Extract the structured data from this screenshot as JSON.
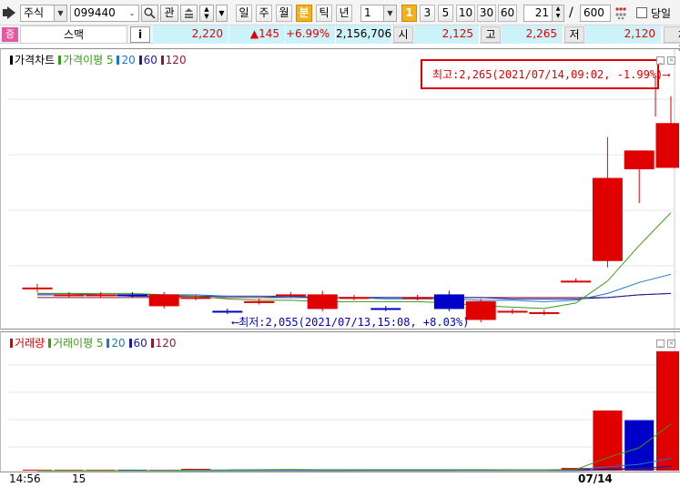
{
  "toolbar": {
    "market_select": "주식",
    "stock_code": "099440",
    "watch_label": "관",
    "period_buttons": [
      "일",
      "주",
      "월",
      "분",
      "틱",
      "년"
    ],
    "active_period": "분",
    "interval_value": "1",
    "interval_presets": [
      "1",
      "3",
      "5",
      "10",
      "30",
      "60"
    ],
    "active_interval": "1",
    "view_count": "21",
    "total_count": "600",
    "separator": "/",
    "same_day_label": "당일"
  },
  "quote": {
    "badge": "증",
    "name": "스맥",
    "info_label": "i",
    "price": "2,220",
    "change": "▲145",
    "change_rate": "+6.99%",
    "volume": "2,156,706",
    "open_label": "시",
    "open": "2,125",
    "high_label": "고",
    "high": "2,265",
    "low_label": "저",
    "low": "2,120",
    "trade_label": "체결강"
  },
  "price_pane": {
    "legend": [
      {
        "label": "가격차트",
        "color": "#000000"
      },
      {
        "label": "가격이평 5",
        "color": "#3a9a1a"
      },
      {
        "label": "20",
        "color": "#1a78c8"
      },
      {
        "label": "60",
        "color": "#1a1aa0"
      },
      {
        "label": "120",
        "color": "#8a1a3a"
      }
    ],
    "high_annotation": "최고:2,265(2021/07/14,09:02, -1.99%)⟶",
    "low_annotation": "⟵최저:2,055(2021/07/13,15:08, +8.03%)"
  },
  "volume_pane": {
    "legend": [
      {
        "label": "거래량",
        "color": "#e00000"
      },
      {
        "label": "거래이평 5",
        "color": "#3a9a1a"
      },
      {
        "label": "20",
        "color": "#1a78c8"
      },
      {
        "label": "60",
        "color": "#1a1aa0"
      },
      {
        "label": "120",
        "color": "#8a1a3a"
      }
    ]
  },
  "time_axis": {
    "labels": [
      "14:56",
      "15",
      "07/14"
    ]
  },
  "colors": {
    "up": "#e00000",
    "down": "#0000c8",
    "ma5": "#3a9a1a",
    "ma20": "#1a78c8",
    "ma60": "#1a1aa0",
    "ma120": "#8a1a3a",
    "active_period": "#f3b21a"
  },
  "chart_data": {
    "type": "candlestick",
    "candles": [
      {
        "open": 2125,
        "close": 2125,
        "high": 2128,
        "low": 2122,
        "dir": "up"
      },
      {
        "open": 2120,
        "close": 2120,
        "high": 2122,
        "low": 2118,
        "dir": "up"
      },
      {
        "open": 2120,
        "close": 2120,
        "high": 2122,
        "low": 2118,
        "dir": "up"
      },
      {
        "open": 2120,
        "close": 2120,
        "high": 2122,
        "low": 2118,
        "dir": "down"
      },
      {
        "open": 2120,
        "close": 2112,
        "high": 2122,
        "low": 2110,
        "dir": "up"
      },
      {
        "open": 2118,
        "close": 2118,
        "high": 2120,
        "low": 2116,
        "dir": "up"
      },
      {
        "open": 2108,
        "close": 2108,
        "high": 2110,
        "low": 2106,
        "dir": "down"
      },
      {
        "open": 2115,
        "close": 2115,
        "high": 2117,
        "low": 2113,
        "dir": "up"
      },
      {
        "open": 2120,
        "close": 2120,
        "high": 2122,
        "low": 2118,
        "dir": "up"
      },
      {
        "open": 2120,
        "close": 2110,
        "high": 2123,
        "low": 2108,
        "dir": "up"
      },
      {
        "open": 2118,
        "close": 2118,
        "high": 2120,
        "low": 2116,
        "dir": "up"
      },
      {
        "open": 2110,
        "close": 2110,
        "high": 2112,
        "low": 2108,
        "dir": "down"
      },
      {
        "open": 2118,
        "close": 2118,
        "high": 2120,
        "low": 2116,
        "dir": "up"
      },
      {
        "open": 2120,
        "close": 2110,
        "high": 2123,
        "low": 2108,
        "dir": "down"
      },
      {
        "open": 2115,
        "close": 2102,
        "high": 2117,
        "low": 2100,
        "dir": "up"
      },
      {
        "open": 2108,
        "close": 2108,
        "high": 2110,
        "low": 2106,
        "dir": "up"
      },
      {
        "open": 2107,
        "close": 2107,
        "high": 2109,
        "low": 2105,
        "dir": "up"
      },
      {
        "open": 2130,
        "close": 2130,
        "high": 2132,
        "low": 2130,
        "dir": "up"
      },
      {
        "open": 2145,
        "close": 2205,
        "high": 2235,
        "low": 2140,
        "dir": "up"
      },
      {
        "open": 2212,
        "close": 2225,
        "high": 2225,
        "low": 2187,
        "dir": "up"
      },
      {
        "open": 2213,
        "close": 2245,
        "high": 2265,
        "low": 2213,
        "dir": "up"
      }
    ],
    "ma5": [
      2121,
      2121,
      2121,
      2121,
      2120,
      2119,
      2117,
      2116,
      2116,
      2115,
      2115,
      2115,
      2115,
      2114,
      2112,
      2111,
      2110,
      2114,
      2130,
      2156,
      2180
    ],
    "ma20": [
      2121,
      2121,
      2120,
      2120,
      2120,
      2120,
      2119,
      2119,
      2118,
      2118,
      2118,
      2117,
      2117,
      2117,
      2116,
      2116,
      2115,
      2116,
      2121,
      2129,
      2135
    ],
    "ma60": [
      2120,
      2120,
      2120,
      2119,
      2119,
      2119,
      2119,
      2119,
      2119,
      2118,
      2118,
      2118,
      2118,
      2118,
      2118,
      2117,
      2117,
      2117,
      2118,
      2120,
      2121
    ],
    "ma120": [
      2118,
      2118,
      2118,
      2118,
      2118,
      2118,
      2118,
      2118,
      2118,
      2118,
      2118,
      2118,
      2118,
      2118,
      2118,
      2118,
      2118,
      2118,
      2118,
      2120,
      2121
    ],
    "y_range": [
      2100,
      2290
    ],
    "volume": [
      {
        "value": 0,
        "dir": "up"
      },
      {
        "value": 0,
        "dir": "up"
      },
      {
        "value": 0,
        "dir": "up"
      },
      {
        "value": 0,
        "dir": "down"
      },
      {
        "value": 1000,
        "dir": "up"
      },
      {
        "value": 2000,
        "dir": "up"
      },
      {
        "value": 1000,
        "dir": "down"
      },
      {
        "value": 1000,
        "dir": "up"
      },
      {
        "value": 1000,
        "dir": "up"
      },
      {
        "value": 1000,
        "dir": "up"
      },
      {
        "value": 1000,
        "dir": "up"
      },
      {
        "value": 1000,
        "dir": "down"
      },
      {
        "value": 1000,
        "dir": "up"
      },
      {
        "value": 1000,
        "dir": "down"
      },
      {
        "value": 1000,
        "dir": "up"
      },
      {
        "value": 0,
        "dir": "up"
      },
      {
        "value": 1000,
        "dir": "up"
      },
      {
        "value": 3000,
        "dir": "up"
      },
      {
        "value": 68000,
        "dir": "up"
      },
      {
        "value": 57000,
        "dir": "down"
      },
      {
        "value": 135000,
        "dir": "up"
      }
    ],
    "vol_ma5": [
      0,
      0,
      0,
      0,
      200,
      600,
      800,
      1000,
      1200,
      1000,
      1000,
      1000,
      1000,
      1000,
      1000,
      800,
      800,
      1200,
      14600,
      25800,
      52600
    ],
    "vol_ma20": [
      0,
      0,
      0,
      0,
      100,
      200,
      300,
      400,
      500,
      600,
      700,
      700,
      800,
      800,
      800,
      800,
      800,
      900,
      4300,
      7100,
      13900
    ],
    "vol_ma60": [
      0,
      0,
      0,
      0,
      0,
      100,
      100,
      200,
      200,
      200,
      300,
      300,
      300,
      300,
      400,
      400,
      400,
      400,
      1600,
      2600,
      4800
    ],
    "vol_ma120": [
      0,
      0,
      0,
      0,
      0,
      0,
      100,
      100,
      100,
      100,
      200,
      200,
      200,
      200,
      200,
      200,
      200,
      200,
      800,
      1300,
      2400
    ],
    "vol_range": [
      0,
      140000
    ]
  }
}
